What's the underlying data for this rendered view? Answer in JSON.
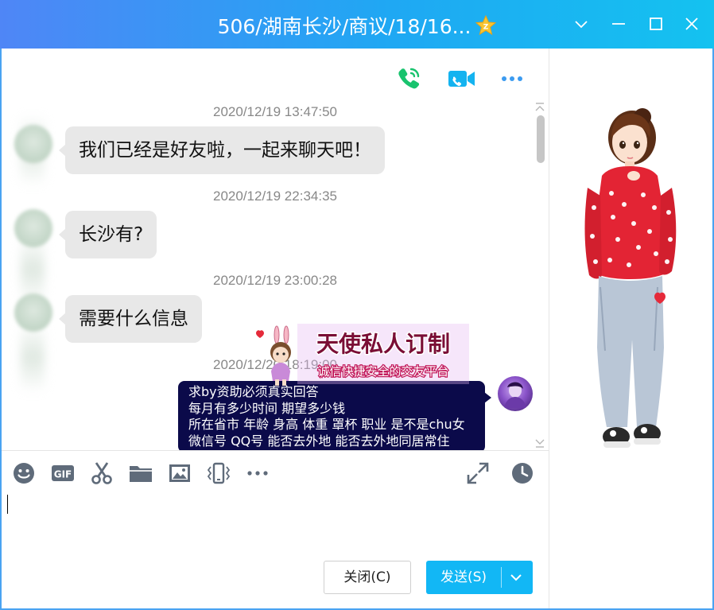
{
  "window": {
    "title": "506/湖南长沙/商议/18/16...",
    "accent": "#12b7f5"
  },
  "messages": [
    {
      "timestamp": "2020/12/19 13:47:50",
      "text": "我们已经是好友啦，一起来聊天吧！",
      "side": "left"
    },
    {
      "timestamp": "2020/12/19 22:34:35",
      "text": "长沙有?",
      "side": "left"
    },
    {
      "timestamp": "2020/12/19 23:00:28",
      "text": "需要什么信息",
      "side": "left"
    },
    {
      "timestamp": "2020/12/20 18:19:00",
      "side": "right",
      "lines": [
        "求by资助必须真实回答",
        "每月有多少时间 期望多少钱",
        "所在省市 年龄 身高 体重 罩杯 职业 是不是chu女",
        "微信号 QQ号 能否去外地 能否去外地同居常住"
      ]
    }
  ],
  "ad": {
    "title": "天使私人订制",
    "subtitle": "诚信快捷安全的交友平台"
  },
  "header_icons": [
    "phone-call-icon",
    "video-call-icon",
    "more-icon"
  ],
  "toolbar": {
    "icons": [
      "emoji-icon",
      "gif-icon",
      "scissors-icon",
      "folder-icon",
      "image-icon",
      "shake-icon",
      "more-icon",
      "expand-icon",
      "history-icon"
    ]
  },
  "buttons": {
    "close": "关闭(C)",
    "send": "发送(S)"
  }
}
